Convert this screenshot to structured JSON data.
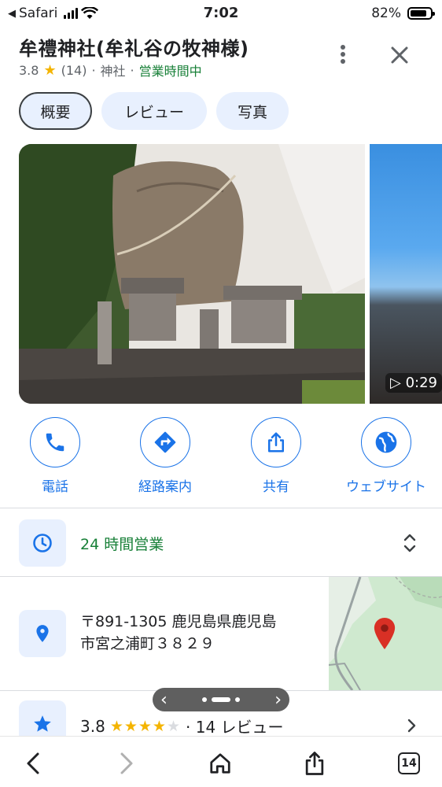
{
  "status_bar": {
    "back_app": "Safari",
    "time": "7:02",
    "battery": "82%",
    "battery_level": 0.82
  },
  "place": {
    "title": "牟禮神社(牟礼谷の牧神様)",
    "rating": "3.8",
    "review_count": "(14)",
    "category": "神社",
    "open_status": "営業時間中"
  },
  "tabs": [
    "概要",
    "レビュー",
    "写真"
  ],
  "photos": {
    "video_duration": "▷ 0:29"
  },
  "actions": [
    {
      "label": "電話",
      "icon": "phone-icon"
    },
    {
      "label": "経路案内",
      "icon": "directions-icon"
    },
    {
      "label": "共有",
      "icon": "share-icon"
    },
    {
      "label": "ウェブサイト",
      "icon": "globe-icon"
    }
  ],
  "hours": {
    "text": "24 時間営業",
    "icon": "clock-icon"
  },
  "address": {
    "line1": "〒891-1305 鹿児島県鹿児島",
    "line2": "市宮之浦町３８２９",
    "icon": "location-pin-icon"
  },
  "rating_row": {
    "value": "3.8",
    "stars": "★★★★",
    "stars_dim": "★",
    "reviews": "· 14 レビュー",
    "icon": "star-icon",
    "rating_fraction": 0.76
  },
  "pager": {
    "prev": "‹",
    "next": "›"
  },
  "bottom_bar": {
    "tabs_count": "14"
  },
  "colors": {
    "accent": "#1a73e8",
    "open_green": "#188038",
    "star": "#f4b400",
    "chip_bg": "#e8f0fe"
  }
}
